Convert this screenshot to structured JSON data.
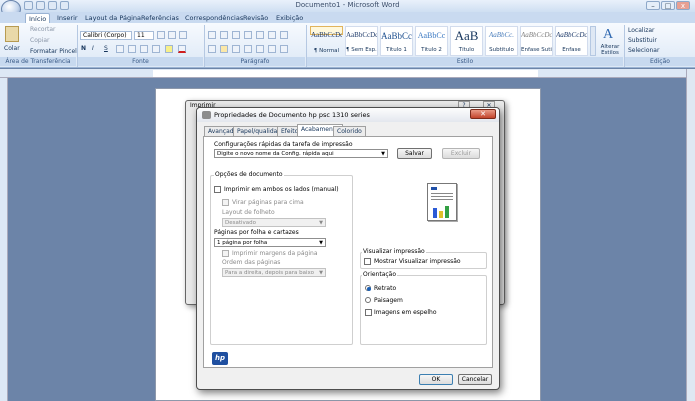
{
  "window": {
    "title": "Documento1 - Microsoft Word",
    "controls": {
      "minimize": "–",
      "maximize": "□",
      "close": "x"
    }
  },
  "tabs": [
    "Início",
    "Inserir",
    "Layout da Página",
    "Referências",
    "Correspondências",
    "Revisão",
    "Exibição"
  ],
  "ribbon": {
    "clipboard": {
      "paste": "Colar",
      "cut": "Recortar",
      "copy": "Copiar",
      "format_painter": "Formatar Pincel",
      "label": "Área de Transferência"
    },
    "font": {
      "name": "Calibri (Corpo)",
      "size": "11",
      "label": "Fonte",
      "bold": "N",
      "italic": "I",
      "underline": "S"
    },
    "paragraph": {
      "label": "Parágrafo"
    },
    "styles": {
      "label": "Estilo",
      "items": [
        {
          "sample": "AaBbCcDc",
          "name": "¶ Normal"
        },
        {
          "sample": "AaBbCcDc",
          "name": "¶ Sem Esp..."
        },
        {
          "sample": "AaBbCc",
          "name": "Título 1"
        },
        {
          "sample": "AaBbCc",
          "name": "Título 2"
        },
        {
          "sample": "AaB",
          "name": "Título"
        },
        {
          "sample": "AaBbCc.",
          "name": "Subtítulo"
        },
        {
          "sample": "AaBbCcDc",
          "name": "Ênfase Sutil"
        },
        {
          "sample": "AaBbCcDc",
          "name": "Ênfase"
        }
      ],
      "change_styles": "Alterar Estilos"
    },
    "editing": {
      "find": "Localizar",
      "replace": "Substituir",
      "select": "Selecionar",
      "label": "Edição"
    }
  },
  "print_dialog": {
    "title": "Imprimir"
  },
  "properties_dialog": {
    "title": "Propriedades de Documento hp psc 1310 series",
    "tabs": [
      "Avançado",
      "Papel/qualidade",
      "Efeitos",
      "Acabamento",
      "Colorido"
    ],
    "active_tab": "Acabamento",
    "quick_sets_label": "Configurações rápidas da tarefa de impressão",
    "quick_sets_value": "Digite o novo nome da Config. rápida aqui",
    "save_button": "Salvar",
    "delete_button": "Excluir",
    "doc_options_label": "Opções de documento",
    "duplex": "Imprimir em ambos os lados (manual)",
    "flip_pages_up": "Virar páginas para cima",
    "booklet_layout_label": "Layout de folheto",
    "booklet_value": "Desativado",
    "pages_per_sheet_label": "Páginas por folha e cartazes",
    "pages_per_sheet_value": "1 página por folha",
    "print_borders": "Imprimir margens da página",
    "page_order_label": "Ordem das páginas",
    "page_order_value": "Para a direita, depois para baixo",
    "preview_label": "Visualizar impressão",
    "show_preview": "Mostrar Visualizar impressão",
    "orientation_label": "Orientação",
    "portrait": "Retrato",
    "landscape": "Paisagem",
    "mirror": "Imagens em espelho",
    "ok_button": "OK",
    "cancel_button": "Cancelar",
    "brand": "hp"
  }
}
